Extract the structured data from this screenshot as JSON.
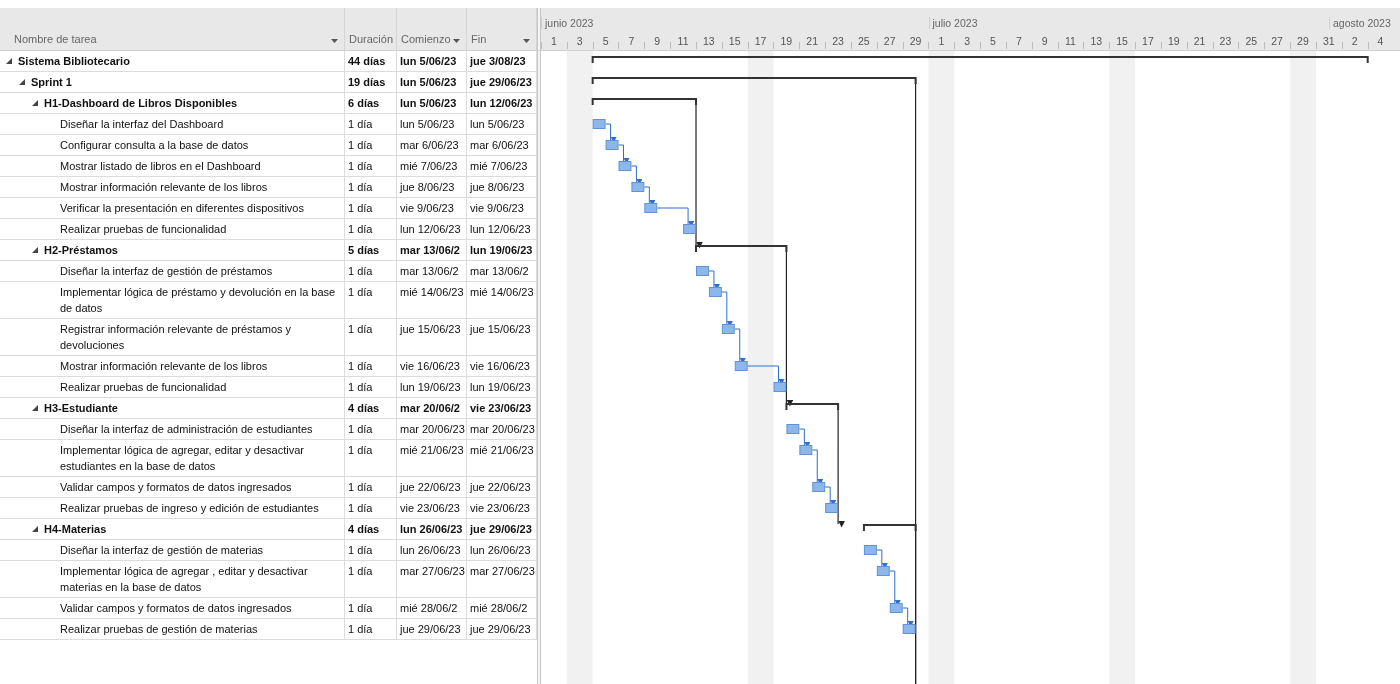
{
  "table": {
    "columns": [
      {
        "label": "Nombre de tarea"
      },
      {
        "label": "Duración"
      },
      {
        "label": "Comienzo"
      },
      {
        "label": "Fin"
      }
    ],
    "rows": [
      {
        "name": "Sistema Bibliotecario",
        "duration": "44 días",
        "start": "lun 5/06/23",
        "finish": "jue 3/08/23",
        "expanded": true,
        "children": [
          {
            "name": "Sprint 1",
            "duration": "19 días",
            "start": "lun 5/06/23",
            "finish": "jue 29/06/23",
            "expanded": true,
            "children": [
              {
                "name": "H1-Dashboard de Libros Disponibles",
                "duration": "6 días",
                "start": "lun 5/06/23",
                "finish": "lun 12/06/23",
                "expanded": true,
                "children": [
                  {
                    "name": "Diseñar la interfaz del Dashboard",
                    "duration": "1 día",
                    "start": "lun 5/06/23",
                    "finish": "lun 5/06/23"
                  },
                  {
                    "name": "Configurar consulta a la base de datos",
                    "duration": "1 día",
                    "start": "mar 6/06/23",
                    "finish": "mar 6/06/23"
                  },
                  {
                    "name": "Mostrar listado de libros en el Dashboard",
                    "duration": "1 día",
                    "start": "mié 7/06/23",
                    "finish": "mié 7/06/23"
                  },
                  {
                    "name": "Mostrar información relevante de los libros",
                    "duration": "1 día",
                    "start": "jue 8/06/23",
                    "finish": "jue 8/06/23"
                  },
                  {
                    "name": "Verificar la presentación en diferentes dispositivos",
                    "duration": "1 día",
                    "start": "vie 9/06/23",
                    "finish": "vie 9/06/23"
                  },
                  {
                    "name": "Realizar pruebas de funcionalidad",
                    "duration": "1 día",
                    "start": "lun 12/06/23",
                    "finish": "lun 12/06/23"
                  }
                ]
              },
              {
                "name": "H2-Préstamos",
                "duration": "5 días",
                "start": "mar 13/06/2",
                "finish": "lun 19/06/23",
                "expanded": true,
                "children": [
                  {
                    "name": "Diseñar la interfaz de gestión de préstamos",
                    "duration": "1 día",
                    "start": "mar 13/06/2",
                    "finish": "mar 13/06/2"
                  },
                  {
                    "name": "Implementar lógica de préstamo y devolución en la base de datos",
                    "duration": "1 día",
                    "start": "mié 14/06/23",
                    "finish": "mié 14/06/23"
                  },
                  {
                    "name": "Registrar información relevante de préstamos y devoluciones",
                    "duration": "1 día",
                    "start": "jue 15/06/23",
                    "finish": "jue 15/06/23"
                  },
                  {
                    "name": "Mostrar información relevante de los libros",
                    "duration": "1 día",
                    "start": "vie 16/06/23",
                    "finish": "vie 16/06/23"
                  },
                  {
                    "name": "Realizar pruebas de funcionalidad",
                    "duration": "1 día",
                    "start": "lun 19/06/23",
                    "finish": "lun 19/06/23"
                  }
                ]
              },
              {
                "name": "H3-Estudiante",
                "duration": "4 días",
                "start": "mar 20/06/2",
                "finish": "vie 23/06/23",
                "expanded": true,
                "children": [
                  {
                    "name": "Diseñar la interfaz de administración de estudiantes",
                    "duration": "1 día",
                    "start": "mar 20/06/23",
                    "finish": "mar 20/06/23"
                  },
                  {
                    "name": "Implementar lógica de agregar, editar y desactivar estudiantes en la base de datos",
                    "duration": "1 día",
                    "start": "mié 21/06/23",
                    "finish": "mié 21/06/23"
                  },
                  {
                    "name": "Validar campos y formatos de datos ingresados",
                    "duration": "1 día",
                    "start": "jue 22/06/23",
                    "finish": "jue 22/06/23"
                  },
                  {
                    "name": "Realizar pruebas de ingreso y edición de estudiantes",
                    "duration": "1 día",
                    "start": "vie 23/06/23",
                    "finish": "vie 23/06/23"
                  }
                ]
              },
              {
                "name": "H4-Materias",
                "duration": "4 días",
                "start": "lun 26/06/23",
                "finish": "jue 29/06/23",
                "expanded": true,
                "children": [
                  {
                    "name": "Diseñar la interfaz de gestión de materias",
                    "duration": "1 día",
                    "start": "lun 26/06/23",
                    "finish": "lun 26/06/23"
                  },
                  {
                    "name": "Implementar lógica de agregar , editar y desactivar materias en la base de datos",
                    "duration": "1 día",
                    "start": "mar 27/06/23",
                    "finish": "mar 27/06/23"
                  },
                  {
                    "name": "Validar campos y formatos de datos ingresados",
                    "duration": "1 día",
                    "start": "mié 28/06/2",
                    "finish": "mié 28/06/2"
                  },
                  {
                    "name": "Realizar pruebas de gestión de materias",
                    "duration": "1 día",
                    "start": "jue 29/06/23",
                    "finish": "jue 29/06/23"
                  }
                ]
              }
            ]
          }
        ]
      }
    ]
  },
  "timeline": {
    "months": [
      {
        "label": "junio 2023"
      },
      {
        "label": "julio 2023"
      },
      {
        "label": "agosto 2023"
      }
    ],
    "days": [
      "1",
      "3",
      "5",
      "7",
      "9",
      "11",
      "13",
      "15",
      "17",
      "19",
      "21",
      "23",
      "25",
      "27",
      "29",
      "1",
      "3",
      "5",
      "7",
      "9",
      "11",
      "13",
      "15",
      "17",
      "19",
      "21",
      "23",
      "25",
      "27",
      "29",
      "31",
      "2",
      "4"
    ]
  }
}
